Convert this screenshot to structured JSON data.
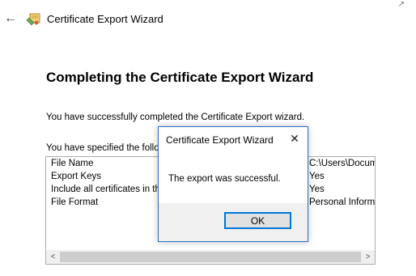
{
  "header": {
    "title": "Certificate Export Wizard",
    "back_icon": "arrow-left-icon",
    "cert_icon": "certificate-icon"
  },
  "main": {
    "heading": "Completing the Certificate Export Wizard",
    "success_text": "You have successfully completed the Certificate Export wizard.",
    "specified_text": "You have specified the following settings:"
  },
  "settings": [
    {
      "name": "File Name",
      "value": "C:\\Users\\Documents\\Connector"
    },
    {
      "name": "Export Keys",
      "value": "Yes"
    },
    {
      "name": "Include all certificates in the certification path",
      "value": "Yes"
    },
    {
      "name": "File Format",
      "value": "Personal Information Exchange (*.pfx)"
    }
  ],
  "scrollbar": {
    "left_arrow": "<",
    "right_arrow": ">"
  },
  "dialog": {
    "title": "Certificate Export Wizard",
    "close_glyph": "✕",
    "message": "The export was successful.",
    "ok_label": "OK"
  }
}
